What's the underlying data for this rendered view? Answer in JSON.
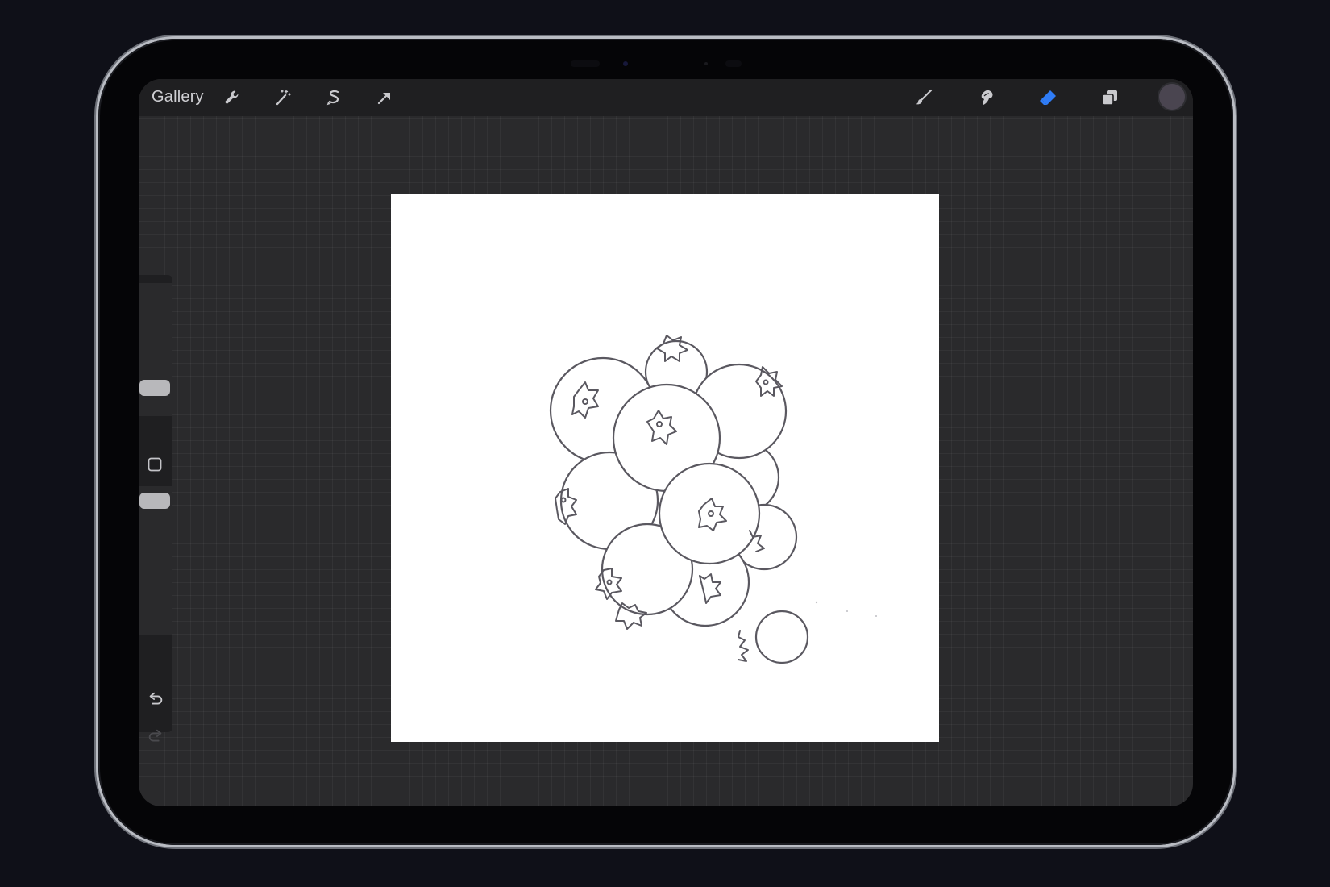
{
  "app": {
    "gallery_label": "Gallery"
  },
  "toolbar": {
    "left_tools": [
      {
        "name": "actions",
        "icon": "wrench-icon"
      },
      {
        "name": "adjustments",
        "icon": "magic-wand-icon"
      },
      {
        "name": "selection",
        "icon": "selection-s-icon"
      },
      {
        "name": "transform",
        "icon": "arrow-cursor-icon"
      }
    ],
    "right_tools": [
      {
        "name": "brush",
        "icon": "brush-icon",
        "active": false
      },
      {
        "name": "smudge",
        "icon": "smudge-icon",
        "active": false
      },
      {
        "name": "eraser",
        "icon": "eraser-icon",
        "active": true
      },
      {
        "name": "layers",
        "icon": "layers-icon",
        "active": false
      }
    ],
    "current_color": "#4a4550",
    "active_color": "#2f7cf6"
  },
  "sidebar": {
    "brush_size_level": 0.53,
    "opacity_level": 0.3,
    "modify_button_icon": "square-icon",
    "undo_icon": "undo-icon",
    "redo_icon": "redo-icon"
  },
  "canvas": {
    "background": "#ffffff",
    "drawing": "blueberry-cluster-sketch"
  }
}
